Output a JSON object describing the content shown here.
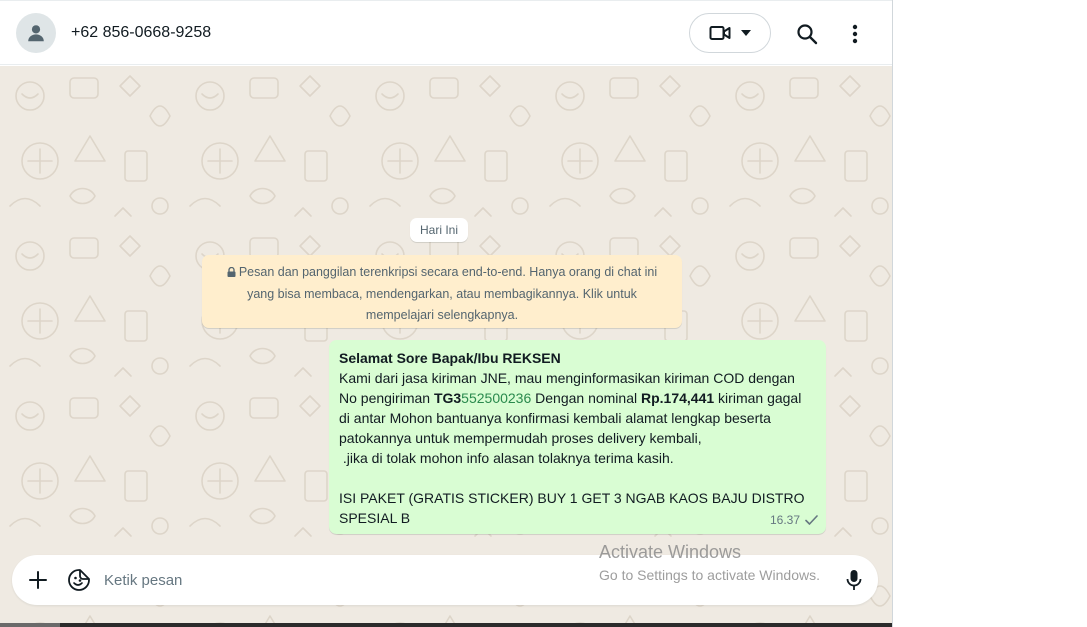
{
  "header": {
    "contact_name": "+62 856-0668-9258",
    "icons": [
      "person-icon",
      "video-call-icon",
      "dropdown-icon",
      "search-icon",
      "menu-dots-icon"
    ]
  },
  "chat": {
    "date_chip": "Hari Ini",
    "encryption_notice": "Pesan dan panggilan terenkripsi secara end-to-end. Hanya orang di chat ini yang bisa membaca, mendengarkan, atau membagikannya. Klik untuk mempelajari selengkapnya.",
    "message": {
      "greeting": "Selamat Sore Bapak/Ibu REKSEN",
      "line1": "Kami dari jasa kiriman JNE, mau menginformasikan kiriman COD dengan",
      "line2_prefix": "No pengiriman ",
      "tracking_prefix": "TG3",
      "tracking_number": "552500236",
      "line2_mid": " Dengan nominal ",
      "amount": "Rp.174,441",
      "line2_suffix": " kiriman gagal",
      "line3": "di antar Mohon bantuanya konfirmasi kembali alamat lengkap beserta",
      "line4": "patokannya untuk mempermudah proses delivery kembali,",
      "line5": " .jika di tolak mohon info alasan tolaknya terima kasih.",
      "line6": "ISI PAKET (GRATIS STICKER) BUY 1 GET 3 NGAB KAOS BAJU DISTRO",
      "line7": "SPESIAL B",
      "time": "16.37",
      "status": "sent"
    }
  },
  "composer": {
    "placeholder": "Ketik pesan"
  },
  "watermark": {
    "title": "Activate Windows",
    "subtitle": "Go to Settings to activate Windows."
  },
  "colors": {
    "bubble_out": "#d9fdd3",
    "notice_bg": "#ffeecd",
    "chat_bg": "#efeae2",
    "tracking_green": "#2a8a4d"
  }
}
